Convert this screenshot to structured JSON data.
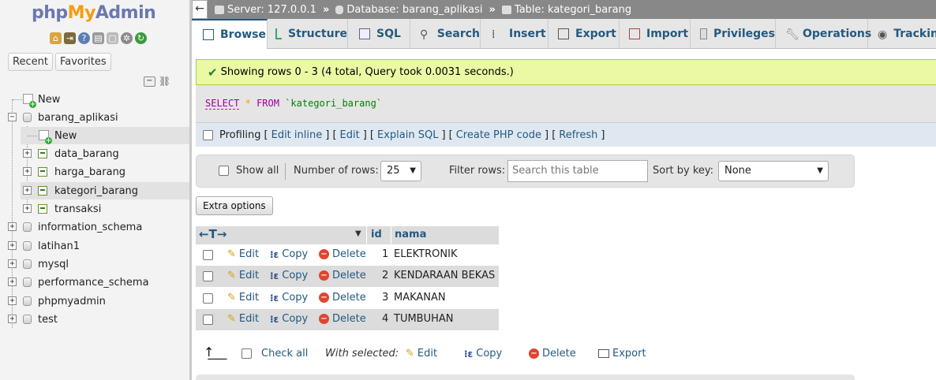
{
  "app": {
    "logo": {
      "php": "php",
      "my": "My",
      "admin": "Admin"
    }
  },
  "sidebar": {
    "tabs": [
      "Recent",
      "Favorites"
    ],
    "tree": [
      {
        "label": "New",
        "kind": "new",
        "level": 0
      },
      {
        "label": "barang_aplikasi",
        "kind": "db",
        "level": 0,
        "expanded": true
      },
      {
        "label": "New",
        "kind": "new",
        "level": 1
      },
      {
        "label": "data_barang",
        "kind": "table",
        "level": 1
      },
      {
        "label": "harga_barang",
        "kind": "table",
        "level": 1
      },
      {
        "label": "kategori_barang",
        "kind": "table",
        "level": 1,
        "selected": true
      },
      {
        "label": "transaksi",
        "kind": "table",
        "level": 1
      },
      {
        "label": "information_schema",
        "kind": "db",
        "level": 0
      },
      {
        "label": "latihan1",
        "kind": "db",
        "level": 0
      },
      {
        "label": "mysql",
        "kind": "db",
        "level": 0
      },
      {
        "label": "performance_schema",
        "kind": "db",
        "level": 0
      },
      {
        "label": "phpmyadmin",
        "kind": "db",
        "level": 0
      },
      {
        "label": "test",
        "kind": "db",
        "level": 0
      }
    ]
  },
  "breadcrumb": {
    "server": "Server: 127.0.0.1",
    "database": "Database: barang_aplikasi",
    "table": "Table: kategori_barang"
  },
  "tabs": [
    {
      "label": "Browse",
      "icon": "browse-icon",
      "active": true
    },
    {
      "label": "Structure",
      "icon": "structure-icon"
    },
    {
      "label": "SQL",
      "icon": "sql-icon"
    },
    {
      "label": "Search",
      "icon": "search-icon"
    },
    {
      "label": "Insert",
      "icon": "insert-icon"
    },
    {
      "label": "Export",
      "icon": "export-icon"
    },
    {
      "label": "Import",
      "icon": "import-icon"
    },
    {
      "label": "Privileges",
      "icon": "privileges-icon"
    },
    {
      "label": "Operations",
      "icon": "operations-icon"
    },
    {
      "label": "Trackin",
      "icon": "tracking-icon"
    }
  ],
  "message": {
    "success": "Showing rows 0 - 3 (4 total, Query took 0.0031 seconds.)"
  },
  "sql": {
    "select": "SELECT",
    "star": "*",
    "from": "FROM",
    "table": "`kategori_barang`"
  },
  "profiling": {
    "label": "Profiling",
    "links": [
      "Edit inline",
      "Edit",
      "Explain SQL",
      "Create PHP code",
      "Refresh"
    ]
  },
  "controls": {
    "show_all": "Show all",
    "rows_label": "Number of rows:",
    "rows_value": "25",
    "filter_label": "Filter rows:",
    "filter_placeholder": "Search this table",
    "sort_label": "Sort by key:",
    "sort_value": "None",
    "extra_options": "Extra options"
  },
  "table": {
    "columns": [
      "id",
      "nama"
    ],
    "action_labels": {
      "edit": "Edit",
      "copy": "Copy",
      "delete": "Delete"
    },
    "rows": [
      {
        "id": "1",
        "nama": "ELEKTRONIK"
      },
      {
        "id": "2",
        "nama": "KENDARAAN BEKAS"
      },
      {
        "id": "3",
        "nama": "MAKANAN"
      },
      {
        "id": "4",
        "nama": "TUMBUHAN"
      }
    ]
  },
  "bulk": {
    "check_all": "Check all",
    "with_selected": "With selected:",
    "edit": "Edit",
    "copy": "Copy",
    "delete": "Delete",
    "export": "Export"
  },
  "colors": {
    "link": "#235a81",
    "success_bg": "#ebf8a4",
    "topbar_bg": "#888888"
  }
}
